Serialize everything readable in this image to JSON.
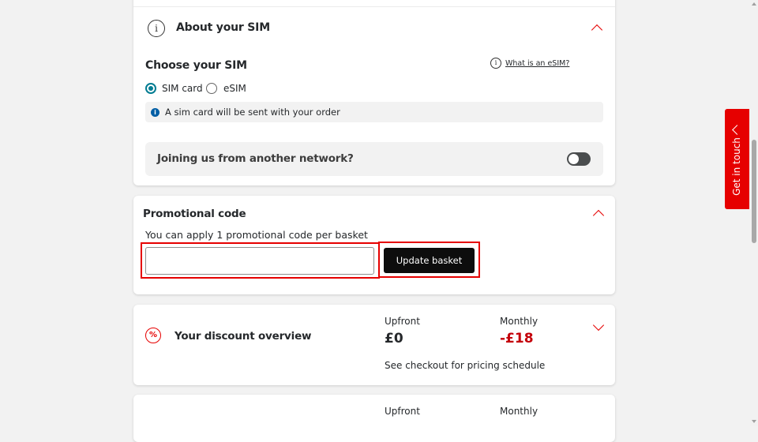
{
  "sim_section": {
    "title": "About your SIM",
    "choose_label": "Choose your SIM",
    "esim_link": "What is an eSIM?",
    "options": [
      {
        "label": "SIM card",
        "selected": true
      },
      {
        "label": "eSIM",
        "selected": false
      }
    ],
    "note": "A sim card will be sent with your order",
    "network_question": "Joining us from another network?",
    "network_toggle_on": false
  },
  "promo": {
    "title": "Promotional code",
    "description": "You can apply 1 promotional code per basket",
    "input_value": "",
    "update_button": "Update basket"
  },
  "discount": {
    "title": "Your discount overview",
    "upfront_label": "Upfront",
    "upfront_value": "£0",
    "monthly_label": "Monthly",
    "monthly_value": "-£18",
    "schedule_note": "See checkout for pricing schedule"
  },
  "next_section": {
    "upfront_label": "Upfront",
    "monthly_label": "Monthly"
  },
  "side_tab": {
    "label": "Get in touch"
  },
  "colors": {
    "accent": "#e60000",
    "radio_selected": "#007c92",
    "discount_red": "#c4000a",
    "info_blue": "#005ea5"
  }
}
